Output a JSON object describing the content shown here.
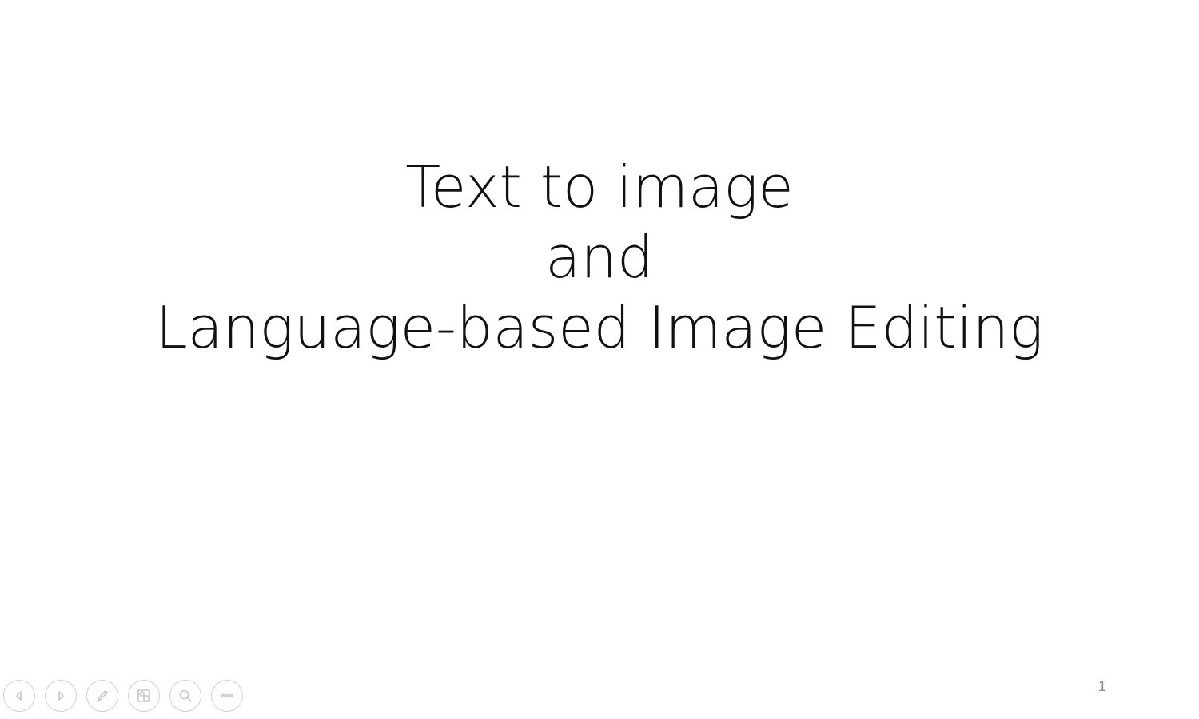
{
  "slide": {
    "title_lines": [
      "Text to image",
      "and",
      "Language-based Image Editing"
    ],
    "slide_number": "1"
  },
  "toolbar": {
    "buttons": [
      {
        "name": "previous-slide-button",
        "icon": "arrow-left-icon"
      },
      {
        "name": "next-slide-button",
        "icon": "arrow-right-icon"
      },
      {
        "name": "pen-tool-button",
        "icon": "pen-icon"
      },
      {
        "name": "see-all-slides-button",
        "icon": "slides-grid-icon"
      },
      {
        "name": "zoom-button",
        "icon": "magnifier-icon"
      },
      {
        "name": "more-options-button",
        "icon": "ellipsis-icon"
      }
    ]
  },
  "colors": {
    "background": "#ffffff",
    "title_text": "#111111",
    "slide_number": "#8a8a8a",
    "toolbar_icon": "#c8c8c8"
  }
}
